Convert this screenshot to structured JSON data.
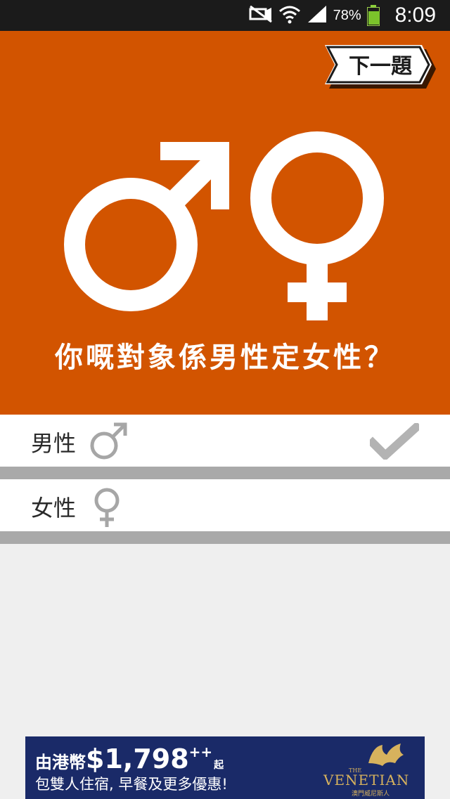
{
  "status_bar": {
    "battery_percent": "78%",
    "battery_level": 0.78,
    "time": "8:09",
    "icons": [
      "mute-icon",
      "wifi-icon",
      "signal-icon",
      "battery-icon"
    ]
  },
  "hero": {
    "background": "#d25400",
    "next_button_label": "下一題",
    "question": "你嘅對象係男性定女性？",
    "icons": [
      "male-symbol-icon",
      "female-symbol-icon"
    ]
  },
  "options": [
    {
      "label": "男性",
      "icon": "male-symbol-icon",
      "selected": true
    },
    {
      "label": "女性",
      "icon": "female-symbol-icon",
      "selected": false
    }
  ],
  "ad": {
    "prefix": "由港幣",
    "price": "$1,798",
    "price_suffix": "++",
    "suffix": "起",
    "subtitle": "包雙人住宿, 早餐及更多優惠!",
    "logo_the": "THE",
    "logo_brand": "VENETIAN",
    "logo_sub": "澳門威尼斯人",
    "colors": {
      "background": "#1a2a68",
      "gold": "#d7b25d"
    }
  }
}
